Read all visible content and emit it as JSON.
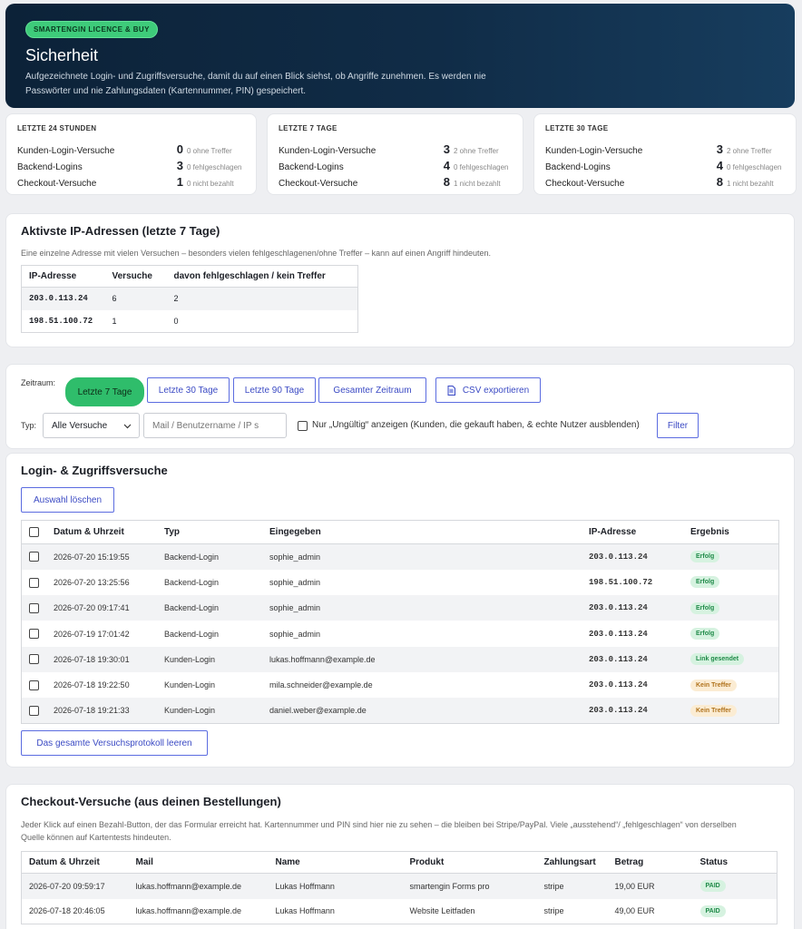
{
  "hero": {
    "badge": "SMARTENGIN LICENCE & BUY",
    "title": "Sicherheit",
    "description": "Aufgezeichnete Login- und Zugriffsversuche, damit du auf einen Blick siehst, ob Angriffe zunehmen. Es werden nie Passwörter und nie Zahlungsdaten (Kartennummer, PIN) gespeichert."
  },
  "stats": [
    {
      "title": "LETZTE 24 STUNDEN",
      "rows": [
        {
          "label": "Kunden-Login-Versuche",
          "value": "0",
          "sub": "0 ohne Treffer"
        },
        {
          "label": "Backend-Logins",
          "value": "3",
          "sub": "0 fehlgeschlagen"
        },
        {
          "label": "Checkout-Versuche",
          "value": "1",
          "sub": "0 nicht bezahlt"
        }
      ]
    },
    {
      "title": "LETZTE 7 TAGE",
      "rows": [
        {
          "label": "Kunden-Login-Versuche",
          "value": "3",
          "sub": "2 ohne Treffer"
        },
        {
          "label": "Backend-Logins",
          "value": "4",
          "sub": "0 fehlgeschlagen"
        },
        {
          "label": "Checkout-Versuche",
          "value": "8",
          "sub": "1 nicht bezahlt"
        }
      ]
    },
    {
      "title": "LETZTE 30 TAGE",
      "rows": [
        {
          "label": "Kunden-Login-Versuche",
          "value": "3",
          "sub": "2 ohne Treffer"
        },
        {
          "label": "Backend-Logins",
          "value": "4",
          "sub": "0 fehlgeschlagen"
        },
        {
          "label": "Checkout-Versuche",
          "value": "8",
          "sub": "1 nicht bezahlt"
        }
      ]
    }
  ],
  "ip_section": {
    "title": "Aktivste IP-Adressen (letzte 7 Tage)",
    "description": "Eine einzelne Adresse mit vielen Versuchen – besonders vielen fehlgeschlagenen/ohne Treffer – kann auf einen Angriff hindeuten.",
    "headers": [
      "IP-Adresse",
      "Versuche",
      "davon fehlgeschlagen / kein Treffer"
    ],
    "rows": [
      [
        "203.0.113.24",
        "6",
        "2"
      ],
      [
        "198.51.100.72",
        "1",
        "0"
      ]
    ]
  },
  "filters": {
    "period_label": "Zeitraum:",
    "period_buttons": [
      "Letzte 7 Tage",
      "Letzte 30 Tage",
      "Letzte 90 Tage",
      "Gesamter Zeitraum"
    ],
    "csv_label": "CSV exportieren",
    "type_label": "Typ:",
    "type_value": "Alle Versuche",
    "search_placeholder": "Mail / Benutzername / IP s",
    "invalid_label": "Nur „Ungültig“ anzeigen (Kunden, die gekauft haben, & echte Nutzer ausblenden)",
    "filter_button": "Filter"
  },
  "log_section": {
    "title": "Login- & Zugriffsversuche",
    "clear_selection": "Auswahl löschen",
    "clear_all": "Das gesamte Versuchsprotokoll leeren",
    "headers": [
      "Datum & Uhrzeit",
      "Typ",
      "Eingegeben",
      "IP-Adresse",
      "Ergebnis"
    ],
    "rows": [
      {
        "date": "2026-07-20 15:19:55",
        "type": "Backend-Login",
        "input": "sophie_admin",
        "ip": "203.0.113.24",
        "result": "Erfolg",
        "kind": "ok"
      },
      {
        "date": "2026-07-20 13:25:56",
        "type": "Backend-Login",
        "input": "sophie_admin",
        "ip": "198.51.100.72",
        "result": "Erfolg",
        "kind": "ok"
      },
      {
        "date": "2026-07-20 09:17:41",
        "type": "Backend-Login",
        "input": "sophie_admin",
        "ip": "203.0.113.24",
        "result": "Erfolg",
        "kind": "ok"
      },
      {
        "date": "2026-07-19 17:01:42",
        "type": "Backend-Login",
        "input": "sophie_admin",
        "ip": "203.0.113.24",
        "result": "Erfolg",
        "kind": "ok"
      },
      {
        "date": "2026-07-18 19:30:01",
        "type": "Kunden-Login",
        "input": "lukas.hoffmann@example.de",
        "ip": "203.0.113.24",
        "result": "Link gesendet",
        "kind": "link"
      },
      {
        "date": "2026-07-18 19:22:50",
        "type": "Kunden-Login",
        "input": "mila.schneider@example.de",
        "ip": "203.0.113.24",
        "result": "Kein Treffer",
        "kind": "none"
      },
      {
        "date": "2026-07-18 19:21:33",
        "type": "Kunden-Login",
        "input": "daniel.weber@example.de",
        "ip": "203.0.113.24",
        "result": "Kein Treffer",
        "kind": "none"
      }
    ]
  },
  "checkout_section": {
    "title": "Checkout-Versuche (aus deinen Bestellungen)",
    "description": "Jeder Klick auf einen Bezahl-Button, der das Formular erreicht hat. Kartennummer und PIN sind hier nie zu sehen – die bleiben bei Stripe/PayPal. Viele „ausstehend“/ „fehlgeschlagen“ von derselben Quelle können auf Kartentests hindeuten.",
    "headers": [
      "Datum & Uhrzeit",
      "Mail",
      "Name",
      "Produkt",
      "Zahlungsart",
      "Betrag",
      "Status"
    ],
    "rows": [
      [
        "2026-07-20 09:59:17",
        "lukas.hoffmann@example.de",
        "Lukas Hoffmann",
        "smartengin Forms pro",
        "stripe",
        "19,00 EUR",
        "PAID"
      ],
      [
        "2026-07-18 20:46:05",
        "lukas.hoffmann@example.de",
        "Lukas Hoffmann",
        "Website Leitfaden",
        "stripe",
        "49,00 EUR",
        "PAID"
      ]
    ]
  },
  "colors": {
    "hero_bg": "#0c2238",
    "accent_green": "#2fbd6b",
    "button_blue": "#3c4bc4"
  },
  "icons": {
    "csv": "document-icon",
    "dropdown": "chevron-down-icon"
  }
}
